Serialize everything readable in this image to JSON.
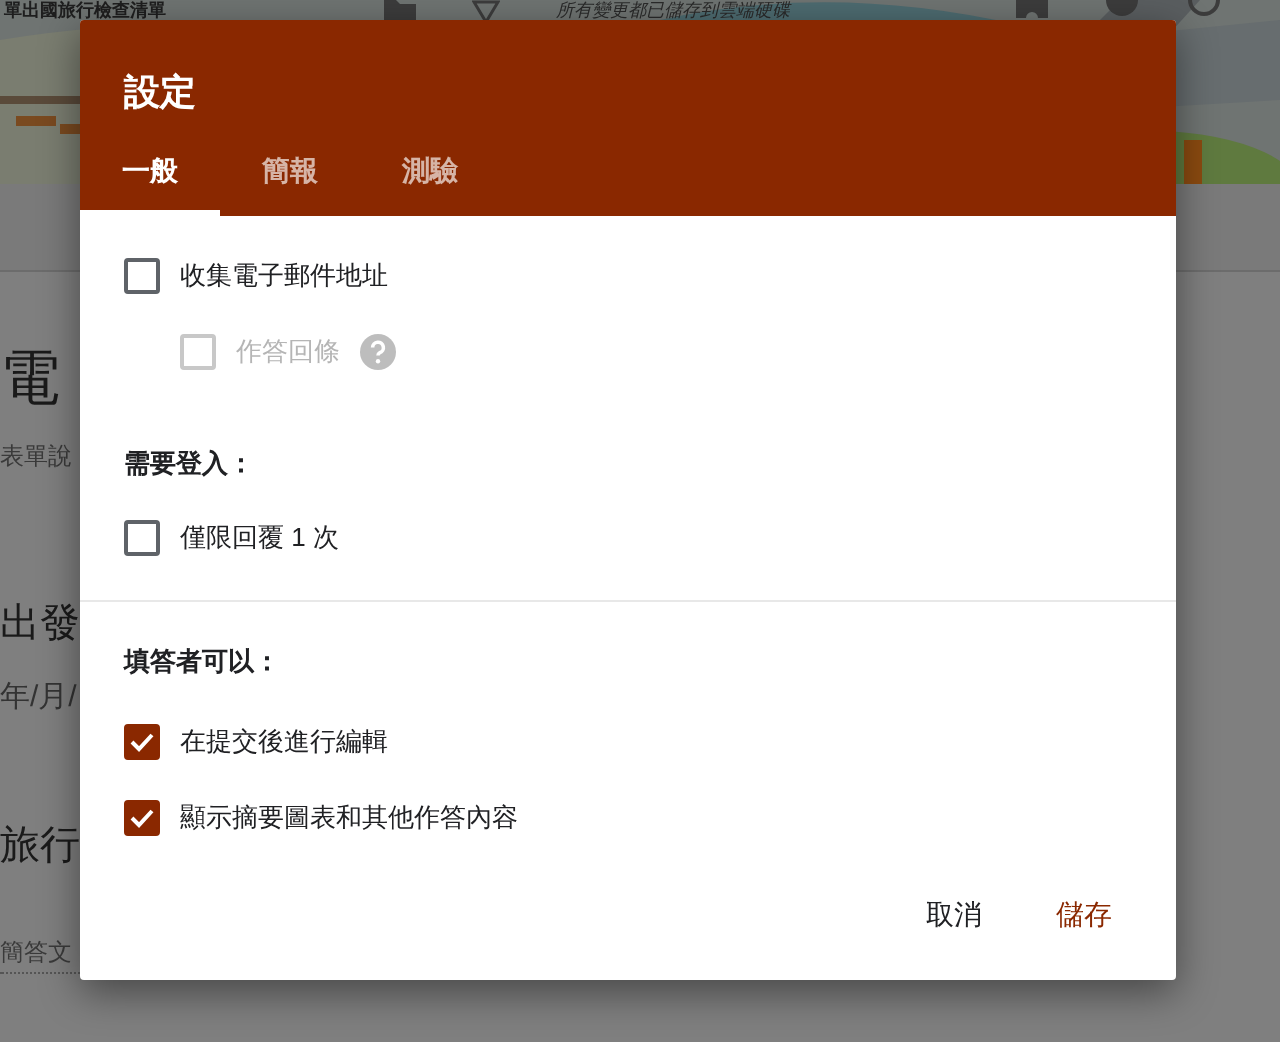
{
  "background": {
    "form_title": "單出國旅行檢查清單",
    "save_status": "所有變更都已儲存到雲端硬碟",
    "fragments": [
      {
        "kind": "heading",
        "text": "電"
      },
      {
        "kind": "hint",
        "text": "表單說"
      },
      {
        "kind": "question",
        "text": "出發"
      },
      {
        "kind": "hint",
        "text": "年/月/"
      },
      {
        "kind": "question",
        "text": "旅行"
      },
      {
        "kind": "answer",
        "text": "簡答文"
      }
    ]
  },
  "dialog": {
    "title": "設定",
    "tabs": [
      {
        "label": "一般",
        "selected": true
      },
      {
        "label": "簡報",
        "selected": false
      },
      {
        "label": "測驗",
        "selected": false
      }
    ],
    "groups": [
      {
        "entries": [
          {
            "kind": "check",
            "label": "收集電子郵件地址",
            "checked": false,
            "disabled": false,
            "children": [
              {
                "kind": "check",
                "label": "作答回條",
                "checked": false,
                "disabled": true,
                "help": true
              }
            ]
          },
          {
            "kind": "heading",
            "label": "需要登入："
          },
          {
            "kind": "check",
            "label": "僅限回覆 1 次",
            "checked": false,
            "disabled": false
          }
        ]
      },
      {
        "entries": [
          {
            "kind": "heading",
            "label": "填答者可以："
          },
          {
            "kind": "check",
            "label": "在提交後進行編輯",
            "checked": true,
            "disabled": false
          },
          {
            "kind": "check",
            "label": "顯示摘要圖表和其他作答內容",
            "checked": true,
            "disabled": false
          }
        ]
      }
    ],
    "buttons": [
      {
        "kind": "plain",
        "label": "取消"
      },
      {
        "kind": "primary",
        "label": "儲存"
      }
    ]
  }
}
